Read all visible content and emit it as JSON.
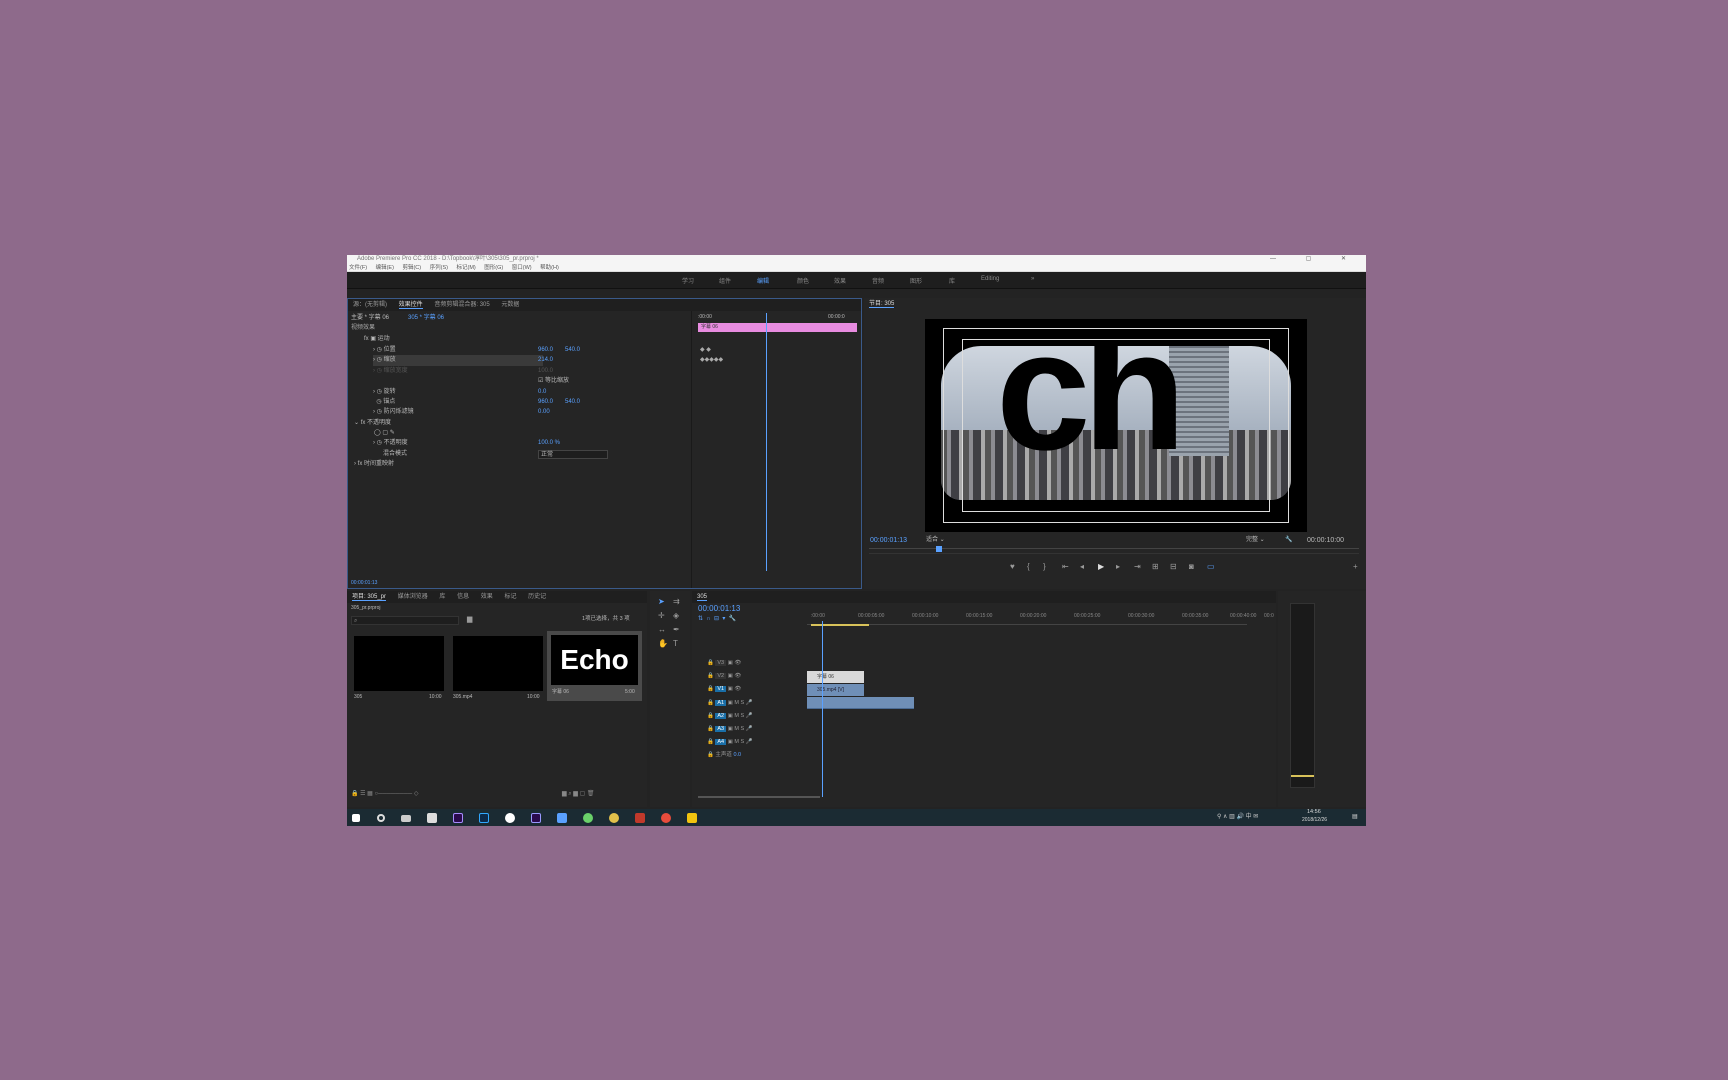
{
  "window": {
    "title": "Adobe Premiere Pro CC 2018 - D:\\Topbook\\淳叶\\305\\305_pr.prproj *",
    "controls": "— ▢ ✕"
  },
  "menu": [
    "文件(F)",
    "编辑(E)",
    "剪辑(C)",
    "序列(S)",
    "标记(M)",
    "图形(G)",
    "窗口(W)",
    "帮助(H)"
  ],
  "workspaces": [
    "学习",
    "组件",
    "编辑",
    "颜色",
    "效果",
    "音频",
    "图形",
    "库",
    "Editing"
  ],
  "workspaces_active": "编辑",
  "effect_controls": {
    "tabs": [
      "源：(无剪辑)",
      "效果控件",
      "音频剪辑混合器: 305",
      "元数据"
    ],
    "active_tab": "效果控件",
    "source_path": "主要 * 字幕 06",
    "sequence_path": "305 * 字幕 06",
    "video_effects_label": "视频效果",
    "timecode_start": ":00:00",
    "timecode_end": "00:00:0",
    "clip_label": "字幕 06",
    "rows": [
      {
        "label": "运动",
        "v1": "",
        "v2": ""
      },
      {
        "label": "位置",
        "v1": "960.0",
        "v2": "540.0"
      },
      {
        "label": "缩放",
        "v1": "214.0",
        "v2": ""
      },
      {
        "label": "缩放宽度",
        "v1": "100.0",
        "v2": ""
      },
      {
        "label": "等比缩放",
        "v1": "",
        "v2": ""
      },
      {
        "label": "旋转",
        "v1": "0.0",
        "v2": ""
      },
      {
        "label": "锚点",
        "v1": "960.0",
        "v2": "540.0"
      },
      {
        "label": "防闪烁滤镜",
        "v1": "0.00",
        "v2": ""
      },
      {
        "label": "不透明度",
        "v1": "",
        "v2": ""
      },
      {
        "label": "不透明度",
        "v1": "100.0 %",
        "v2": ""
      },
      {
        "label": "混合模式",
        "v1": "正常",
        "v2": ""
      },
      {
        "label": "时间重映射",
        "v1": "",
        "v2": ""
      }
    ],
    "footer_timecode": "00:00:01:13"
  },
  "program_monitor": {
    "title": "节目: 305",
    "timecode": "00:00:01:13",
    "fit": "适合",
    "quality": "完整",
    "duration": "00:00:10:00",
    "overlay_text": "ch"
  },
  "project": {
    "tabs": [
      "项目: 305_pr",
      "媒体浏览器",
      "库",
      "信息",
      "效果",
      "标记",
      "历史记"
    ],
    "file": "305_pr.prproj",
    "selection": "1项已选择，共 3 项",
    "search_placeholder": "",
    "items": [
      {
        "name": "305",
        "dur": "10:00"
      },
      {
        "name": "305.mp4",
        "dur": "10:00"
      },
      {
        "name": "字幕 06",
        "dur": "5:00",
        "thumb_text": "Echo"
      }
    ]
  },
  "timeline": {
    "tab": "305",
    "timecode": "00:00:01:13",
    "ruler": [
      ":00:00",
      "00:00:05:00",
      "00:00:10:00",
      "00:00:15:00",
      "00:00:20:00",
      "00:00:25:00",
      "00:00:30:00",
      "00:00:35:00",
      "00:00:40:00",
      "00:0"
    ],
    "video_tracks": [
      "V3",
      "V2",
      "V1"
    ],
    "audio_tracks": [
      "A1",
      "A2",
      "A3",
      "A4"
    ],
    "master": "主声道",
    "master_val": "0.0",
    "clip_title": "字幕 06",
    "clip_video": "305.mp4 [V]",
    "clip_audio": ""
  },
  "taskbar": {
    "time": "14:56",
    "date": "2018/12/26",
    "lang": "中"
  },
  "colors": {
    "accent": "#5aa1ff",
    "clip_pink": "#e88ce0",
    "clip_blue": "#6f8fb7",
    "background": "#8e6a8b"
  }
}
